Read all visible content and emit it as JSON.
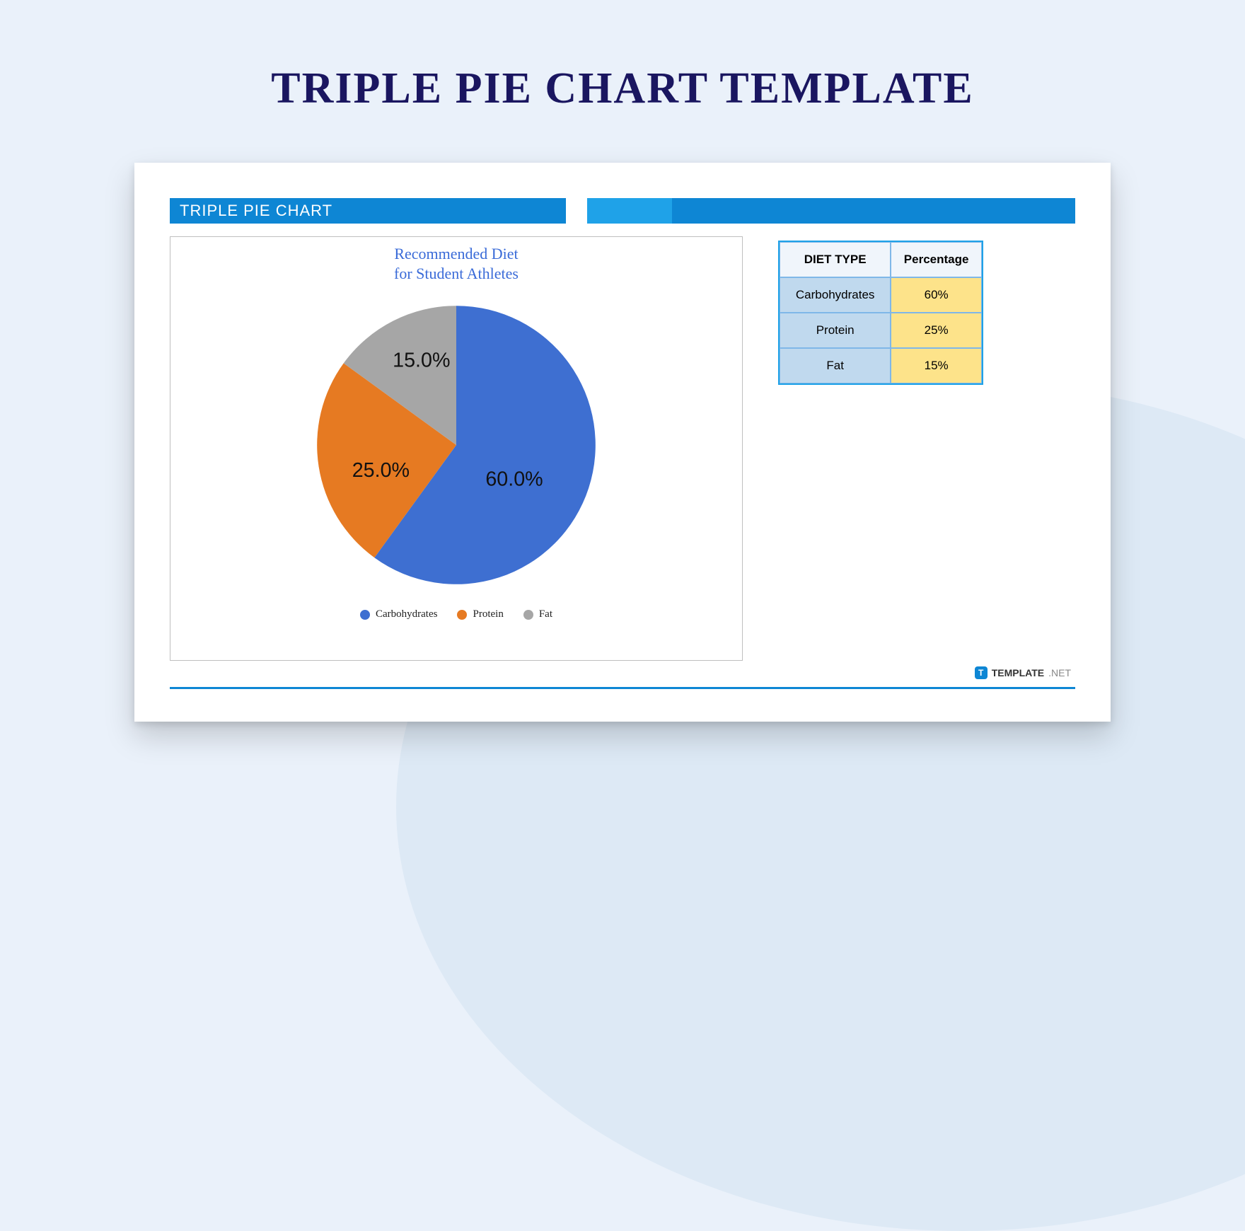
{
  "page_title": "TRIPLE PIE CHART TEMPLATE",
  "banner_label": "TRIPLE PIE CHART",
  "chart_title_line1": "Recommended Diet",
  "chart_title_line2": "for Student Athletes",
  "table": {
    "headers": {
      "col1": "DIET TYPE",
      "col2": "Percentage"
    },
    "rows": [
      {
        "label": "Carbohydrates",
        "value": "60%"
      },
      {
        "label": "Protein",
        "value": "25%"
      },
      {
        "label": "Fat",
        "value": "15%"
      }
    ]
  },
  "legend": {
    "items": [
      {
        "label": "Carbohydrates",
        "color": "#3e6fd1"
      },
      {
        "label": "Protein",
        "color": "#e67a22"
      },
      {
        "label": "Fat",
        "color": "#a6a6a6"
      }
    ]
  },
  "slice_labels": {
    "carb": "60.0%",
    "protein": "25.0%",
    "fat": "15.0%"
  },
  "colors": {
    "carb": "#3e6fd1",
    "protein": "#e67a22",
    "fat": "#a6a6a6"
  },
  "brand": {
    "name": "TEMPLATE",
    "suffix": ".NET"
  },
  "chart_data": {
    "type": "pie",
    "title": "Recommended Diet for Student Athletes",
    "series": [
      {
        "name": "Carbohydrates",
        "value": 60,
        "color": "#3e6fd1"
      },
      {
        "name": "Protein",
        "value": 25,
        "color": "#e67a22"
      },
      {
        "name": "Fat",
        "value": 15,
        "color": "#a6a6a6"
      }
    ],
    "unit": "percent"
  }
}
